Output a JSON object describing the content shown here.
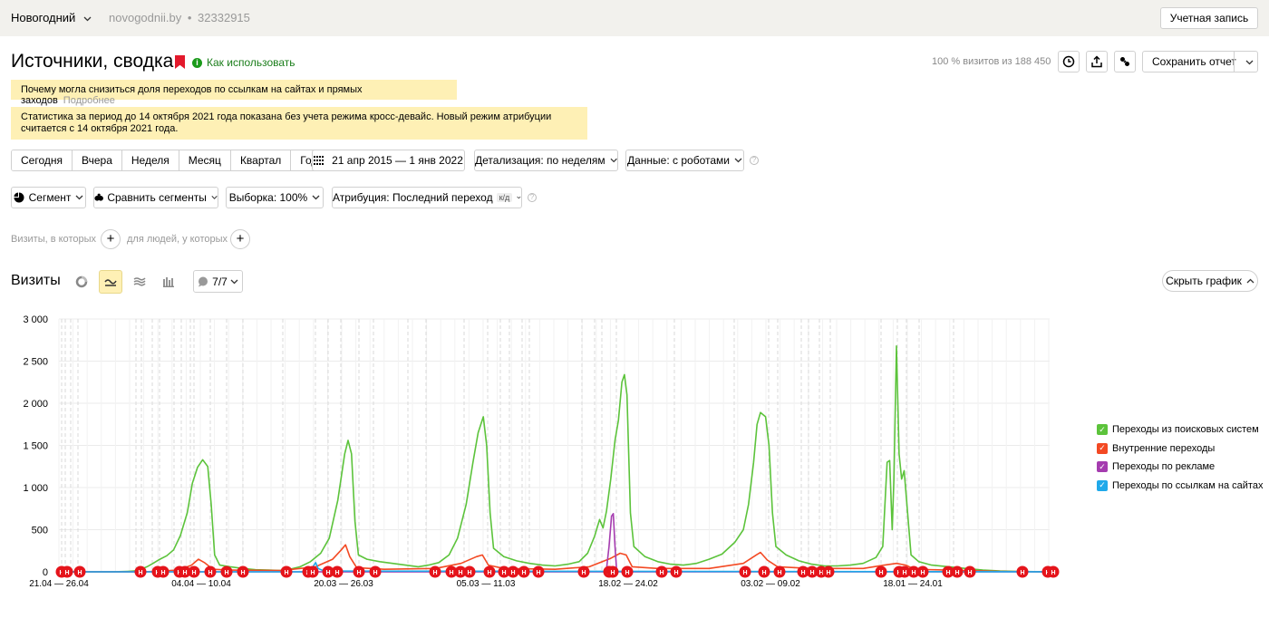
{
  "header": {
    "counter_name": "Новогодний",
    "site": "novogodnii.by",
    "counter_id": "32332915",
    "account_label": "Учетная запись"
  },
  "report": {
    "title": "Источники, сводка",
    "howto_label": "Как использовать",
    "visits_summary": "100 % визитов из 188 450",
    "save_label": "Сохранить отчет"
  },
  "notices": {
    "drop_text": "Почему могла снизиться доля переходов по ссылкам на сайтах и прямых заходов",
    "drop_more": "Подробнее",
    "attribution_text": "Статистика за период до 14 октября 2021 года показана без учета режима кросс-девайс. Новый режим атрибуции считается с 14 октября 2021 года."
  },
  "periods": [
    "Сегодня",
    "Вчера",
    "Неделя",
    "Месяц",
    "Квартал",
    "Год"
  ],
  "date_range": "21 апр 2015 — 1 янв 2022",
  "detail_label": "Детализация: по неделям",
  "data_label": "Данные: с роботами",
  "segment_label": "Сегмент",
  "compare_label": "Сравнить сегменты",
  "sample_label": "Выборка: 100%",
  "attribution_label": "Атрибуция: Последний переход",
  "attribution_tag": "к/д",
  "filters": {
    "visits_where": "Визиты, в которых",
    "people_where": "для людей, у которых"
  },
  "chart_section": {
    "title": "Визиты",
    "series_count": "7/7",
    "hide_label": "Скрыть график"
  },
  "chart_data": {
    "type": "line",
    "ylim": [
      0,
      3000
    ],
    "yticks": [
      "3 000",
      "2 500",
      "2 000",
      "1 500",
      "1 000",
      "500",
      "0"
    ],
    "xtick_labels": [
      "21.04 — 26.04",
      "04.04 — 10.04",
      "20.03 — 26.03",
      "05.03 — 11.03",
      "18.02 — 24.02",
      "03.02 — 09.02",
      "18.01 — 24.01"
    ],
    "series": [
      {
        "name": "Переходы из поисковых систем",
        "color": "#5cc33b",
        "points": [
          [
            0,
            0
          ],
          [
            50,
            0
          ],
          [
            60,
            0
          ],
          [
            70,
            2
          ],
          [
            80,
            5
          ],
          [
            88,
            10
          ],
          [
            96,
            30
          ],
          [
            103,
            60
          ],
          [
            110,
            100
          ],
          [
            118,
            150
          ],
          [
            126,
            190
          ],
          [
            134,
            260
          ],
          [
            142,
            430
          ],
          [
            150,
            700
          ],
          [
            156,
            1050
          ],
          [
            162,
            1240
          ],
          [
            168,
            1330
          ],
          [
            174,
            1250
          ],
          [
            178,
            800
          ],
          [
            182,
            200
          ],
          [
            188,
            80
          ],
          [
            200,
            60
          ],
          [
            215,
            40
          ],
          [
            230,
            25
          ],
          [
            245,
            20
          ],
          [
            258,
            15
          ],
          [
            270,
            30
          ],
          [
            282,
            60
          ],
          [
            294,
            120
          ],
          [
            306,
            220
          ],
          [
            316,
            400
          ],
          [
            326,
            850
          ],
          [
            334,
            1400
          ],
          [
            338,
            1560
          ],
          [
            342,
            1400
          ],
          [
            346,
            600
          ],
          [
            350,
            200
          ],
          [
            360,
            150
          ],
          [
            375,
            120
          ],
          [
            390,
            100
          ],
          [
            405,
            80
          ],
          [
            420,
            60
          ],
          [
            432,
            80
          ],
          [
            444,
            110
          ],
          [
            456,
            200
          ],
          [
            466,
            400
          ],
          [
            476,
            800
          ],
          [
            484,
            1300
          ],
          [
            490,
            1650
          ],
          [
            496,
            1840
          ],
          [
            500,
            1500
          ],
          [
            504,
            700
          ],
          [
            508,
            280
          ],
          [
            520,
            180
          ],
          [
            535,
            130
          ],
          [
            550,
            100
          ],
          [
            565,
            80
          ],
          [
            580,
            70
          ],
          [
            595,
            90
          ],
          [
            608,
            120
          ],
          [
            618,
            220
          ],
          [
            626,
            420
          ],
          [
            632,
            620
          ],
          [
            636,
            520
          ],
          [
            640,
            720
          ],
          [
            645,
            1100
          ],
          [
            650,
            1560
          ],
          [
            654,
            1800
          ],
          [
            658,
            2250
          ],
          [
            661,
            2340
          ],
          [
            664,
            2100
          ],
          [
            668,
            700
          ],
          [
            672,
            300
          ],
          [
            685,
            180
          ],
          [
            700,
            120
          ],
          [
            715,
            90
          ],
          [
            730,
            80
          ],
          [
            745,
            100
          ],
          [
            760,
            150
          ],
          [
            775,
            210
          ],
          [
            790,
            350
          ],
          [
            800,
            500
          ],
          [
            806,
            800
          ],
          [
            812,
            1300
          ],
          [
            816,
            1750
          ],
          [
            820,
            1890
          ],
          [
            826,
            1840
          ],
          [
            830,
            1500
          ],
          [
            834,
            700
          ],
          [
            838,
            300
          ],
          [
            850,
            200
          ],
          [
            865,
            130
          ],
          [
            880,
            90
          ],
          [
            895,
            70
          ],
          [
            910,
            70
          ],
          [
            925,
            80
          ],
          [
            940,
            100
          ],
          [
            955,
            170
          ],
          [
            963,
            300
          ],
          [
            968,
            1300
          ],
          [
            971,
            1320
          ],
          [
            974,
            500
          ],
          [
            976,
            1100
          ],
          [
            979,
            2680
          ],
          [
            982,
            1400
          ],
          [
            985,
            1100
          ],
          [
            988,
            1200
          ],
          [
            992,
            700
          ],
          [
            996,
            200
          ],
          [
            1005,
            120
          ],
          [
            1020,
            80
          ],
          [
            1040,
            60
          ],
          [
            1060,
            40
          ],
          [
            1080,
            20
          ],
          [
            1100,
            10
          ],
          [
            1120,
            5
          ],
          [
            1140,
            2
          ],
          [
            1158,
            0
          ]
        ]
      },
      {
        "name": "Внутренние переходы",
        "color": "#f34923",
        "points": [
          [
            0,
            0
          ],
          [
            100,
            0
          ],
          [
            140,
            20
          ],
          [
            155,
            80
          ],
          [
            163,
            150
          ],
          [
            170,
            110
          ],
          [
            180,
            30
          ],
          [
            200,
            20
          ],
          [
            260,
            15
          ],
          [
            300,
            60
          ],
          [
            320,
            150
          ],
          [
            330,
            260
          ],
          [
            335,
            320
          ],
          [
            340,
            180
          ],
          [
            348,
            50
          ],
          [
            380,
            30
          ],
          [
            440,
            40
          ],
          [
            470,
            100
          ],
          [
            488,
            180
          ],
          [
            495,
            200
          ],
          [
            502,
            80
          ],
          [
            520,
            40
          ],
          [
            580,
            30
          ],
          [
            620,
            60
          ],
          [
            645,
            160
          ],
          [
            656,
            220
          ],
          [
            663,
            200
          ],
          [
            670,
            60
          ],
          [
            700,
            40
          ],
          [
            760,
            40
          ],
          [
            800,
            100
          ],
          [
            815,
            200
          ],
          [
            820,
            230
          ],
          [
            828,
            140
          ],
          [
            840,
            60
          ],
          [
            880,
            40
          ],
          [
            940,
            40
          ],
          [
            965,
            80
          ],
          [
            979,
            100
          ],
          [
            990,
            80
          ],
          [
            1000,
            30
          ],
          [
            1040,
            20
          ],
          [
            1100,
            5
          ],
          [
            1158,
            0
          ]
        ]
      },
      {
        "name": "Переходы по рекламе",
        "color": "#a53caf",
        "points": [
          [
            0,
            0
          ],
          [
            636,
            0
          ],
          [
            640,
            30
          ],
          [
            643,
            300
          ],
          [
            646,
            660
          ],
          [
            648,
            690
          ],
          [
            650,
            300
          ],
          [
            652,
            0
          ],
          [
            1158,
            0
          ]
        ]
      },
      {
        "name": "Переходы по ссылкам на сайтах",
        "color": "#1fa9ea",
        "points": [
          [
            0,
            0
          ],
          [
            290,
            0
          ],
          [
            297,
            60
          ],
          [
            300,
            110
          ],
          [
            303,
            40
          ],
          [
            310,
            10
          ],
          [
            1158,
            0
          ]
        ]
      }
    ]
  }
}
